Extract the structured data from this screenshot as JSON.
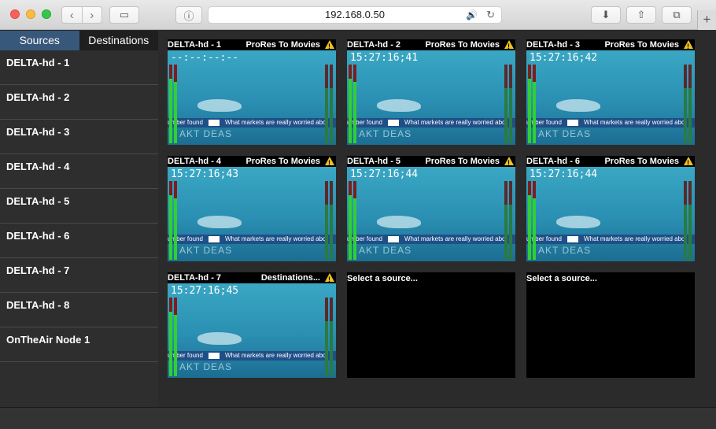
{
  "browser": {
    "url": "192.168.0.50",
    "icons": {
      "back": "chevron-left-icon",
      "forward": "chevron-right-icon",
      "sidebar": "sidebar-icon",
      "privacy": "info-icon",
      "audio": "speaker-icon",
      "reload": "reload-icon",
      "download": "download-icon",
      "share": "share-icon",
      "tabs": "tabs-icon",
      "new_tab": "plus-icon"
    }
  },
  "sidebar": {
    "tabs": [
      {
        "label": "Sources",
        "active": true
      },
      {
        "label": "Destinations",
        "active": false
      }
    ],
    "items": [
      {
        "label": "DELTA-hd - 1"
      },
      {
        "label": "DELTA-hd - 2"
      },
      {
        "label": "DELTA-hd - 3"
      },
      {
        "label": "DELTA-hd - 4"
      },
      {
        "label": "DELTA-hd - 5"
      },
      {
        "label": "DELTA-hd - 6"
      },
      {
        "label": "DELTA-hd - 7"
      },
      {
        "label": "DELTA-hd - 8"
      },
      {
        "label": "OnTheAir Node 1"
      }
    ]
  },
  "tiles": [
    {
      "name": "DELTA-hd - 1",
      "destination": "ProRes To Movies",
      "timecode": "--:--:--:--",
      "ticker_a": "umber found",
      "ticker_b": "What markets are really worried abo",
      "logo": "AKT DEAS"
    },
    {
      "name": "DELTA-hd - 2",
      "destination": "ProRes To Movies",
      "timecode": "15:27:16;41",
      "ticker_a": "umber found",
      "ticker_b": "What markets are really worried abo",
      "logo": "AKT DEAS"
    },
    {
      "name": "DELTA-hd - 3",
      "destination": "ProRes To Movies",
      "timecode": "15:27:16;42",
      "ticker_a": "umber found",
      "ticker_b": "What markets are really worried abo",
      "logo": "AKT DEAS"
    },
    {
      "name": "DELTA-hd - 4",
      "destination": "ProRes To Movies",
      "timecode": "15:27:16;43",
      "ticker_a": "umber found",
      "ticker_b": "What markets are really worried abo",
      "logo": "AKT DEAS"
    },
    {
      "name": "DELTA-hd - 5",
      "destination": "ProRes To Movies",
      "timecode": "15:27:16;44",
      "ticker_a": "umber found",
      "ticker_b": "What markets are really worried abo",
      "logo": "AKT DEAS"
    },
    {
      "name": "DELTA-hd - 6",
      "destination": "ProRes To Movies",
      "timecode": "15:27:16;44",
      "ticker_a": "umber found",
      "ticker_b": "What markets are really worried abo",
      "logo": "AKT DEAS"
    },
    {
      "name": "DELTA-hd - 7",
      "destination": "Destinations...",
      "timecode": "15:27:16;45",
      "ticker_a": "umber found",
      "ticker_b": "What markets are really worried abo",
      "logo": "AKT DEAS"
    }
  ],
  "empty_tiles": [
    {
      "label": "Select a source..."
    },
    {
      "label": "Select a source..."
    }
  ],
  "colors": {
    "tab_active": "#37587a",
    "meter_green": "#2fd02f",
    "warning": "#f0c020"
  }
}
